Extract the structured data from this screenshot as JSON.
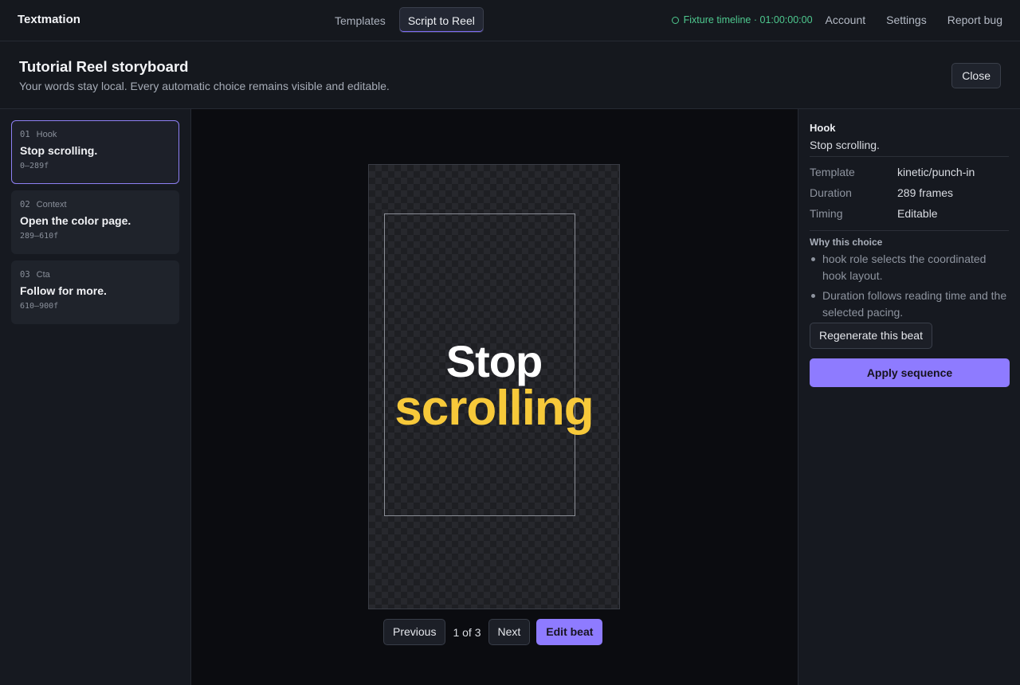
{
  "app": {
    "brand": "Textmation"
  },
  "top_tabs": [
    {
      "label": "Templates",
      "active": false
    },
    {
      "label": "Script to Reel",
      "active": true
    }
  ],
  "status": {
    "text": "Fixture timeline · 01:00:00:00",
    "color": "#4ec98f"
  },
  "nav": {
    "account": "Account",
    "settings": "Settings",
    "report_bug": "Report bug"
  },
  "header": {
    "title": "Tutorial Reel storyboard",
    "subtitle": "Your words stay local. Every automatic choice remains visible and editable.",
    "close_label": "Close"
  },
  "beats": [
    {
      "num": "01",
      "role": "Hook",
      "title": "Stop scrolling.",
      "range": "0–289f",
      "active": true
    },
    {
      "num": "02",
      "role": "Context",
      "title": "Open the color page.",
      "range": "289–610f",
      "active": false
    },
    {
      "num": "03",
      "role": "Cta",
      "title": "Follow for more.",
      "range": "610–900f",
      "active": false
    }
  ],
  "preview": {
    "line1": "Stop",
    "line2": "scrolling",
    "accent_color": "#f7c93a"
  },
  "pager": {
    "previous": "Previous",
    "count": "1 of 3",
    "next": "Next",
    "edit": "Edit beat"
  },
  "inspector": {
    "role": "Hook",
    "text": "Stop scrolling.",
    "props": [
      {
        "key": "Template",
        "value": "kinetic/punch-in"
      },
      {
        "key": "Duration",
        "value": "289 frames"
      },
      {
        "key": "Timing",
        "value": "Editable"
      }
    ],
    "why_title": "Why this choice",
    "why": [
      "hook role selects the coordinated hook layout.",
      "Duration follows reading time and the selected pacing."
    ],
    "regenerate": "Regenerate this beat",
    "apply": "Apply sequence"
  },
  "colors": {
    "accent": "#8e7bff",
    "background": "#13151b"
  }
}
